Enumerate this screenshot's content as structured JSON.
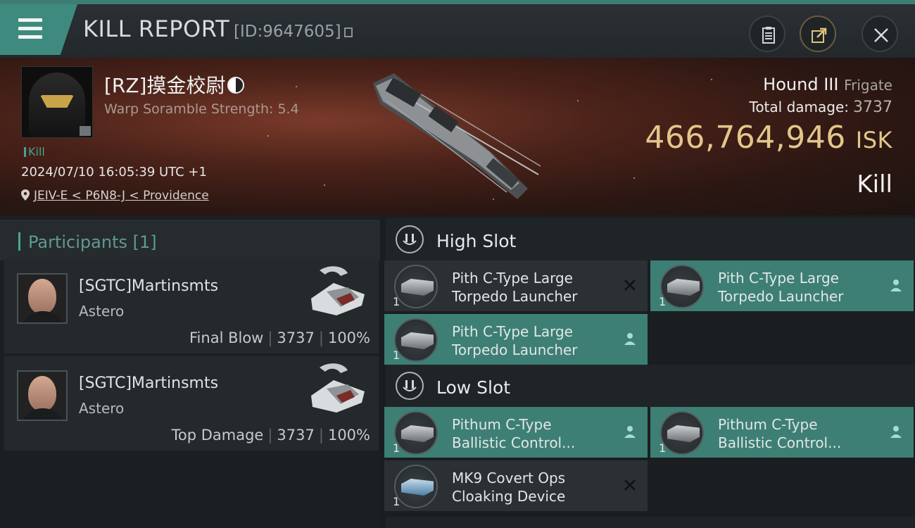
{
  "header": {
    "title": "KILL REPORT",
    "report_id": "[ID:9647605]"
  },
  "victim": {
    "name": "[RZ]摸金校尉",
    "scramble": "Warp Soramble Strength: 5.4",
    "kill_tag": "Kill",
    "datetime": "2024/07/10 16:05:39 UTC +1",
    "location": "JEIV-E < P6N8-J < Providence"
  },
  "ship": {
    "name": "Hound III",
    "class": "Frigate",
    "total_damage_label": "Total damage:",
    "total_damage": "3737",
    "isk_value": "466,764,946",
    "isk_unit": "ISK",
    "result": "Kill"
  },
  "participants": {
    "title": "Participants [1]",
    "items": [
      {
        "name": "[SGTC]Martinsmts",
        "ship": "Astero",
        "role": "Final Blow",
        "damage": "3737",
        "percent": "100%"
      },
      {
        "name": "[SGTC]Martinsmts",
        "ship": "Astero",
        "role": "Top Damage",
        "damage": "3737",
        "percent": "100%"
      }
    ]
  },
  "fitting": {
    "high_slot": {
      "label": "High Slot",
      "modules": [
        {
          "name_line1": "Pith C-Type Large",
          "name_line2": "Torpedo Launcher",
          "qty": "1",
          "status": "destroyed"
        },
        {
          "name_line1": "Pith C-Type Large",
          "name_line2": "Torpedo Launcher",
          "qty": "1",
          "status": "dropped"
        },
        {
          "name_line1": "Pith C-Type Large",
          "name_line2": "Torpedo Launcher",
          "qty": "1",
          "status": "dropped"
        }
      ]
    },
    "low_slot": {
      "label": "Low Slot",
      "modules": [
        {
          "name_line1": "Pithum C-Type",
          "name_line2": "Ballistic Control...",
          "qty": "1",
          "status": "dropped"
        },
        {
          "name_line1": "Pithum C-Type",
          "name_line2": "Ballistic Control...",
          "qty": "1",
          "status": "dropped"
        },
        {
          "name_line1": "MK9 Covert Ops",
          "name_line2": "Cloaking Device",
          "qty": "1",
          "status": "destroyed"
        }
      ]
    }
  },
  "colors": {
    "accent": "#3f8a7e",
    "isk": "#e3c68a",
    "dropped_bg": "#3d7f74"
  }
}
